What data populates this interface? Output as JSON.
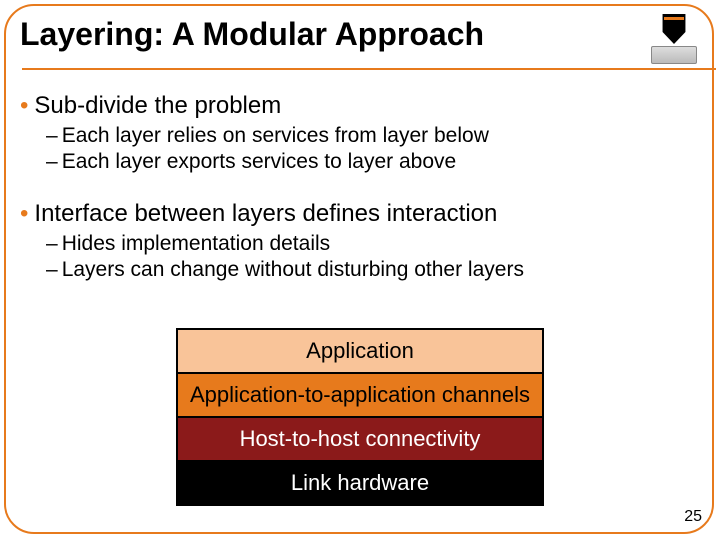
{
  "title": "Layering: A Modular Approach",
  "bullets": {
    "b1": "Sub-divide the problem",
    "b1a": "Each layer relies on services from layer below",
    "b1b": "Each layer exports services to layer above",
    "b2": "Interface between layers defines interaction",
    "b2a": "Hides implementation details",
    "b2b": "Layers can change without disturbing other layers"
  },
  "layers": {
    "l0": "Application",
    "l1": "Application-to-application channels",
    "l2": "Host-to-host connectivity",
    "l3": "Link hardware"
  },
  "page_number": "25",
  "colors": {
    "accent": "#E77A1C",
    "layer0_bg": "#F9C499",
    "layer1_bg": "#E77A1C",
    "layer2_bg": "#8B1A1A",
    "layer3_bg": "#000000"
  }
}
